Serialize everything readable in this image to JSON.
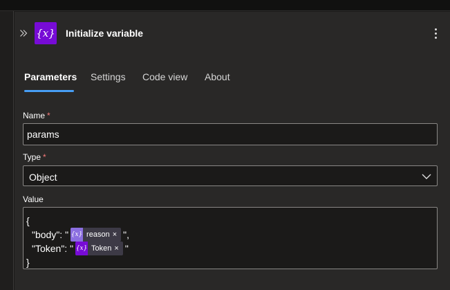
{
  "panel": {
    "title": "Initialize variable",
    "icon": "variable-icon",
    "icon_glyph": "{x}",
    "accent": "#770bd6"
  },
  "tabs": [
    {
      "label": "Parameters",
      "active": true
    },
    {
      "label": "Settings",
      "active": false
    },
    {
      "label": "Code view",
      "active": false
    },
    {
      "label": "About",
      "active": false
    }
  ],
  "fields": {
    "name": {
      "label": "Name",
      "required_mark": "*",
      "value": "params"
    },
    "type": {
      "label": "Type",
      "required_mark": "*",
      "value": "Object"
    },
    "value": {
      "label": "Value",
      "open_brace": "{",
      "close_brace": "}",
      "lines": [
        {
          "prefix": "\"body\": \"",
          "token": {
            "label": "reason",
            "close": "×",
            "glyph": "{x}"
          },
          "suffix": "\","
        },
        {
          "prefix": "\"Token\": \"",
          "token": {
            "label": "Token",
            "close": "×",
            "glyph": "{x}"
          },
          "suffix": "\""
        }
      ]
    }
  }
}
